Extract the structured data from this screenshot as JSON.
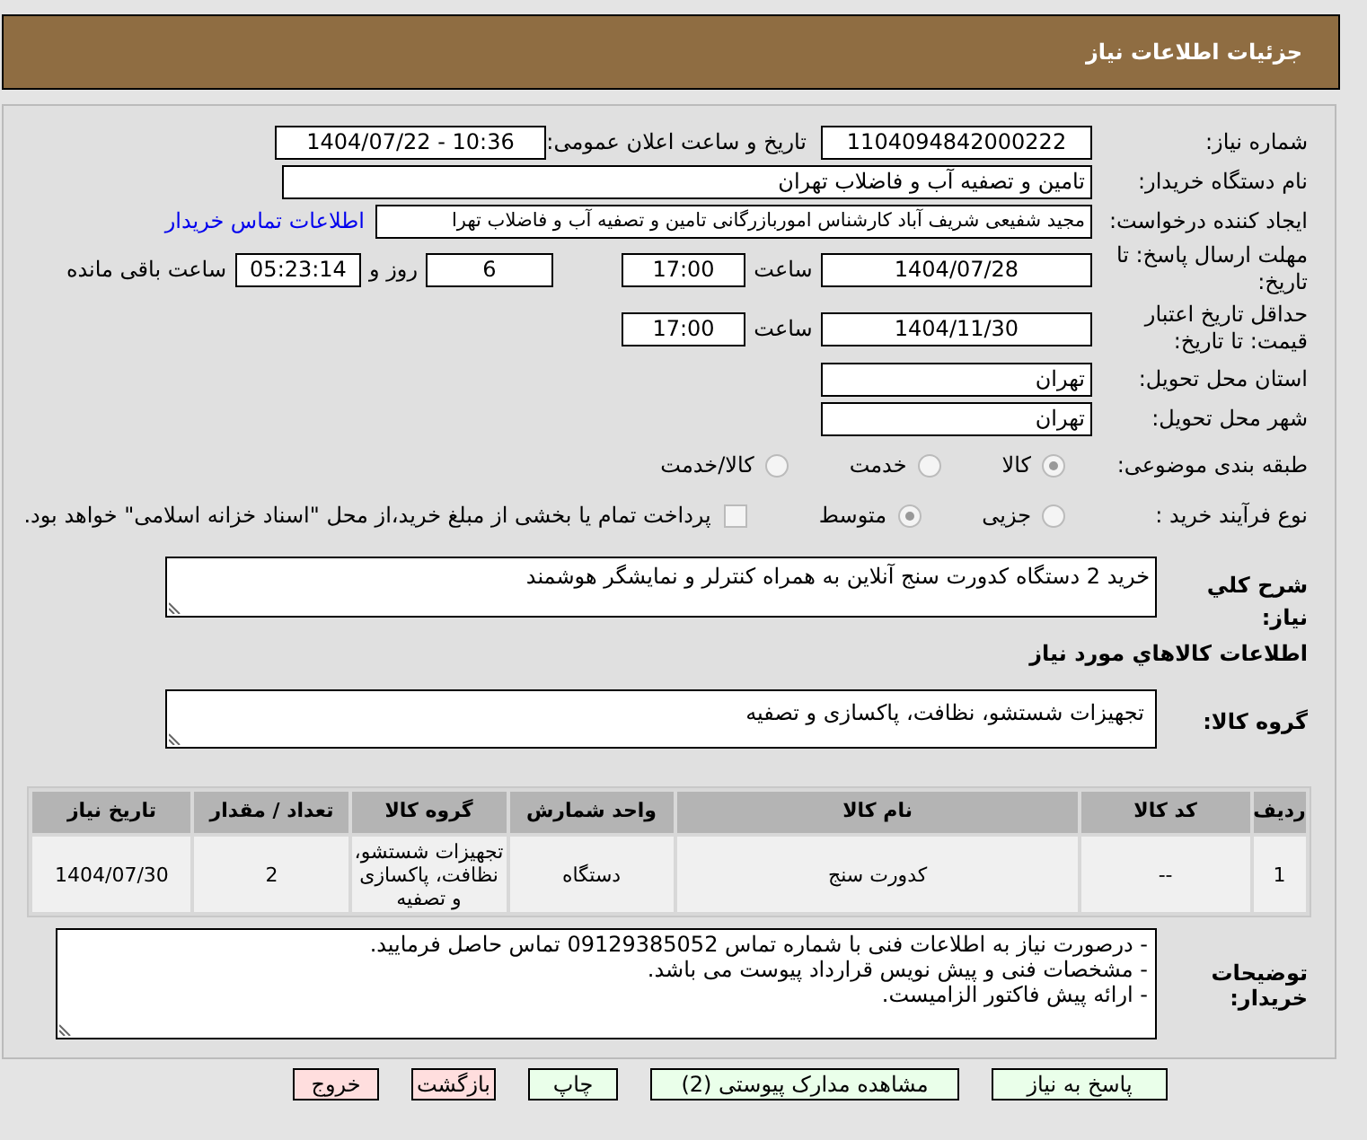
{
  "header": {
    "title": "جزئیات اطلاعات نیاز"
  },
  "need_number": {
    "label": "شماره نیاز:",
    "value": "1104094842000222"
  },
  "announce": {
    "label": "تاریخ و ساعت اعلان عمومی:",
    "value": "1404/07/22 - 10:36"
  },
  "buyer_org": {
    "label": "نام دستگاه خریدار:",
    "value": "تامین و تصفیه آب و فاضلاب تهران"
  },
  "requester": {
    "label": "ایجاد کننده درخواست:",
    "value": "مجید شفیعی شریف آباد کارشناس اموربازرگانی تامین و تصفیه آب و فاضلاب تهرا",
    "link": "اطلاعات تماس خریدار"
  },
  "deadline": {
    "label": "مهلت ارسال پاسخ: تا تاریخ:",
    "date": "1404/07/28",
    "time_label": "ساعت",
    "time": "17:00",
    "days": "6",
    "days_label": "روز و",
    "remaining": "05:23:14",
    "remaining_label": "ساعت باقی مانده"
  },
  "validity": {
    "label": "حداقل تاریخ اعتبار قیمت: تا تاریخ:",
    "date": "1404/11/30",
    "time_label": "ساعت",
    "time": "17:00"
  },
  "province": {
    "label": "استان محل تحویل:",
    "value": "تهران"
  },
  "city": {
    "label": "شهر محل تحویل:",
    "value": "تهران"
  },
  "category": {
    "label": "طبقه بندی موضوعی:",
    "options": [
      {
        "label": "کالا",
        "selected": true
      },
      {
        "label": "خدمت",
        "selected": false
      },
      {
        "label": "کالا/خدمت",
        "selected": false
      }
    ]
  },
  "process": {
    "label": "نوع فرآیند خرید :",
    "options": [
      {
        "label": "جزیی",
        "selected": false
      },
      {
        "label": "متوسط",
        "selected": true
      }
    ],
    "treasury": {
      "checked": false,
      "label": "پرداخت تمام یا بخشی از مبلغ خرید،از محل \"اسناد خزانه اسلامی\" خواهد بود."
    }
  },
  "summary": {
    "label": "شرح کلي نياز:",
    "value": "خرید 2 دستگاه کدورت سنج آنلاین به همراه کنترلر و نمایشگر هوشمند"
  },
  "goods_heading": "اطلاعات کالاهاي مورد نياز",
  "goods_group": {
    "label": "گروه کالا:",
    "value": "تجهیزات شستشو، نظافت، پاکسازی و تصفیه"
  },
  "table": {
    "columns": [
      "ردیف",
      "کد کالا",
      "نام کالا",
      "واحد شمارش",
      "گروه کالا",
      "تعداد / مقدار",
      "تاریخ نیاز"
    ],
    "rows": [
      [
        "1",
        "--",
        "کدورت سنج",
        "دستگاه",
        "تجهیزات شستشو، نظافت، پاکسازی و تصفیه",
        "2",
        "1404/07/30"
      ]
    ]
  },
  "buyer_notes": {
    "label": "توضیحات خریدار:",
    "lines": [
      "- درصورت نیاز به اطلاعات فنی با شماره تماس 09129385052 تماس حاصل فرمایید.",
      "- مشخصات فنی و پیش نویس قرارداد پیوست می باشد.",
      "- ارائه پیش فاکتور الزامیست."
    ]
  },
  "buttons": [
    {
      "label": "پاسخ به نیاز",
      "kind": "primary"
    },
    {
      "label": "مشاهده مدارک پیوستی (2)",
      "kind": "primary"
    },
    {
      "label": "چاپ",
      "kind": "primary"
    },
    {
      "label": "بازگشت",
      "kind": "danger"
    },
    {
      "label": "خروج",
      "kind": "danger"
    }
  ]
}
